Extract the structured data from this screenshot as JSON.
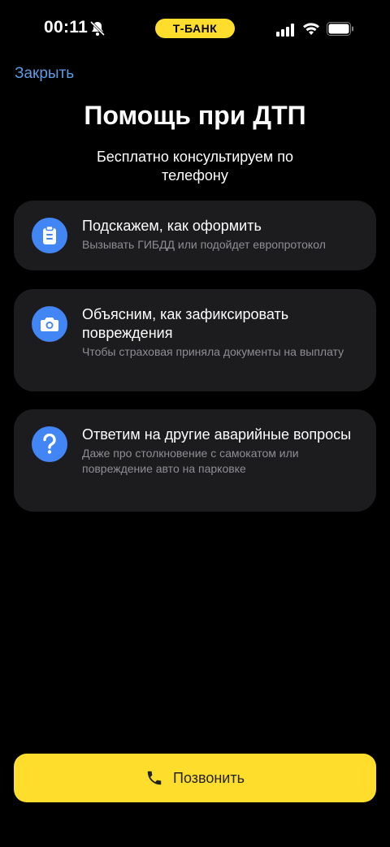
{
  "status_bar": {
    "time": "00:11",
    "carrier": "Т-БАНК"
  },
  "header": {
    "close_label": "Закрыть"
  },
  "main": {
    "title": "Помощь при ДТП",
    "subtitle": "Бесплатно консультируем по телефону",
    "cards": [
      {
        "icon": "clipboard-icon",
        "title": "Подскажем, как оформить",
        "desc": "Вызывать ГИБДД или подойдет европротокол"
      },
      {
        "icon": "camera-icon",
        "title": "Объясним, как зафиксировать повреждения",
        "desc": "Чтобы страховая приняла документы на выплату"
      },
      {
        "icon": "question-icon",
        "title": "Ответим на другие аварийные вопросы",
        "desc": "Даже про столкновение с самокатом или повреждение авто на парковке"
      }
    ]
  },
  "footer": {
    "call_label": "Позвонить"
  },
  "colors": {
    "accent": "#FFDD2D",
    "icon_bg": "#4285F4",
    "link": "#5B9BE6",
    "card_bg": "#1C1C1E"
  }
}
